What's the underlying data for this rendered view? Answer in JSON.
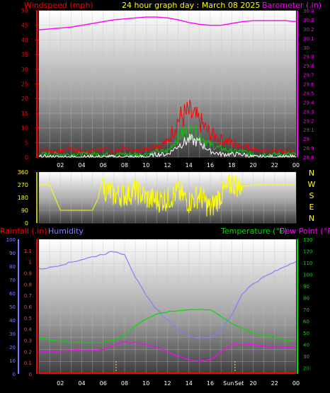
{
  "header": {
    "windspeed_label": "Windspeed (mph)",
    "title": "24 hour graph day : March 08 2025",
    "barometer_label": "Barometer (.in)"
  },
  "colors": {
    "wind_gust": "#ff0000",
    "wind_avg": "#00cc00",
    "wind_low": "#ffffff",
    "barometer": "#ff00ff",
    "direction": "#ffff00",
    "rain": "#ff0000",
    "humidity": "#7f7fff",
    "temperature": "#00dd00",
    "dewpoint": "#ff00ff",
    "sun_marker": "#ffff00"
  },
  "chart_data": [
    {
      "type": "line",
      "title": "24 hour graph day : March 08 2025",
      "x_tick_labels": [
        "02",
        "04",
        "06",
        "08",
        "10",
        "12",
        "14",
        "16",
        "18",
        "20",
        "22",
        "00"
      ],
      "ylabel_left": "Windspeed (mph)",
      "ylim_left": [
        0,
        50
      ],
      "y_ticks_left": [
        "0",
        "5",
        "10",
        "15",
        "20",
        "25",
        "30",
        "35",
        "40",
        "45",
        "50"
      ],
      "ylabel_right": "Barometer (.in)",
      "ylim_right": [
        28.8,
        30.4
      ],
      "y_ticks_right": [
        "28.8",
        "28.9",
        "29",
        "29.1",
        "29.2",
        "29.3",
        "29.4",
        "29.5",
        "29.6",
        "29.7",
        "29.8",
        "29.9",
        "30",
        "30.1",
        "30.2",
        "30.3",
        "30.4"
      ],
      "grid": true,
      "x": [
        0,
        1,
        2,
        3,
        4,
        5,
        6,
        7,
        8,
        9,
        10,
        11,
        12,
        13,
        14,
        15,
        16,
        17,
        18,
        19,
        20,
        21,
        22,
        23,
        24
      ],
      "series": [
        {
          "name": "Barometer (.in)",
          "axis": "right",
          "values": [
            30.19,
            30.2,
            30.21,
            30.22,
            30.24,
            30.26,
            30.28,
            30.3,
            30.31,
            30.32,
            30.33,
            30.33,
            30.32,
            30.3,
            30.27,
            30.25,
            30.24,
            30.24,
            30.26,
            30.28,
            30.29,
            30.29,
            30.29,
            30.29,
            30.28
          ]
        },
        {
          "axis": "left",
          "values": [
            3,
            2,
            2,
            3,
            2,
            2,
            3,
            2,
            3,
            2,
            3,
            4,
            5,
            13,
            15,
            12,
            8,
            6,
            5,
            4,
            3,
            2,
            2,
            2,
            2
          ]
        },
        {
          "axis": "left",
          "values": [
            1,
            1,
            1,
            1,
            1,
            1,
            1,
            1,
            1,
            1,
            1,
            2,
            2,
            7,
            9,
            8,
            4,
            3,
            2,
            2,
            1,
            1,
            1,
            1,
            1
          ]
        },
        {
          "axis": "left",
          "values": [
            0,
            0,
            0,
            0,
            0,
            0,
            0,
            0,
            0,
            0,
            0,
            1,
            1,
            4,
            6,
            5,
            2,
            1,
            1,
            1,
            0,
            0,
            0,
            0,
            0
          ]
        }
      ]
    },
    {
      "type": "line",
      "y_ticks": [
        "0",
        "90",
        "180",
        "270",
        "360"
      ],
      "ylim": [
        0,
        360
      ],
      "compass_labels": [
        "N",
        "W",
        "S",
        "E",
        "N"
      ],
      "x": [
        0,
        1,
        2,
        3,
        4,
        5,
        6,
        7,
        8,
        9,
        10,
        11,
        12,
        13,
        14,
        15,
        16,
        17,
        18,
        19,
        20,
        21,
        22,
        23,
        24
      ],
      "series": [
        {
          "values": [
            270,
            270,
            90,
            90,
            90,
            90,
            250,
            200,
            200,
            230,
            180,
            160,
            170,
            220,
            150,
            200,
            100,
            200,
            280,
            260,
            270,
            270,
            270,
            270,
            270
          ]
        }
      ]
    },
    {
      "type": "line",
      "left_label": "Rainfall (.in)",
      "left_label_2": "Humidity",
      "right_label": "Temperature (°F)",
      "right_label_2": "Dew Point (°F)",
      "humidity_ticks": [
        "0",
        "10",
        "20",
        "30",
        "40",
        "50",
        "60",
        "70",
        "80",
        "90",
        "100"
      ],
      "humidity_ylim": [
        0,
        100
      ],
      "rain_ticks": [
        "0",
        "0.1",
        "0.2",
        "0.3",
        "0.4",
        "0.5",
        "0.6",
        "0.7",
        "0.8",
        "0.9",
        "1",
        "1.1"
      ],
      "rain_ylim": [
        0,
        1.2
      ],
      "temp_ticks": [
        "20",
        "30",
        "40",
        "50",
        "60",
        "70",
        "80",
        "90",
        "100",
        "110",
        "120",
        "130"
      ],
      "temp_ylim": [
        15,
        130
      ],
      "x_tick_labels": [
        "02",
        "04",
        "06",
        "08",
        "10",
        "12",
        "14",
        "16",
        "Sun",
        "Set",
        "20",
        "22",
        "00"
      ],
      "sunrise_hour": 7.2,
      "sunset_hour": 18.3,
      "x": [
        0,
        1,
        2,
        3,
        4,
        5,
        6,
        7,
        8,
        9,
        10,
        11,
        12,
        13,
        14,
        15,
        16,
        17,
        18,
        19,
        20,
        21,
        22,
        23,
        24
      ],
      "series": [
        {
          "name": "Humidity",
          "axis": "humidity",
          "values": [
            78,
            79,
            81,
            83,
            85,
            87,
            89,
            91,
            89,
            72,
            58,
            48,
            40,
            33,
            28,
            27,
            27,
            32,
            44,
            60,
            67,
            72,
            76,
            80,
            84
          ]
        },
        {
          "name": "Temperature (°F)",
          "axis": "temp",
          "values": [
            45,
            44,
            43,
            42,
            42,
            42,
            42,
            44,
            48,
            56,
            62,
            66,
            68,
            69,
            70,
            70,
            70,
            64,
            58,
            54,
            50,
            48,
            46,
            44,
            43
          ]
        },
        {
          "name": "Dew Point (°F)",
          "axis": "temp",
          "values": [
            34,
            34,
            34,
            35,
            35,
            35,
            36,
            40,
            42,
            42,
            40,
            38,
            34,
            30,
            27,
            26,
            27,
            34,
            40,
            40,
            40,
            39,
            38,
            38,
            37
          ]
        },
        {
          "name": "Rainfall (.in)",
          "axis": "rain",
          "values": [
            0,
            0,
            0,
            0,
            0,
            0,
            0,
            0,
            0,
            0,
            0,
            0,
            0,
            0,
            0,
            0,
            0,
            0,
            0,
            0,
            0,
            0,
            0,
            0,
            0
          ]
        }
      ]
    }
  ]
}
